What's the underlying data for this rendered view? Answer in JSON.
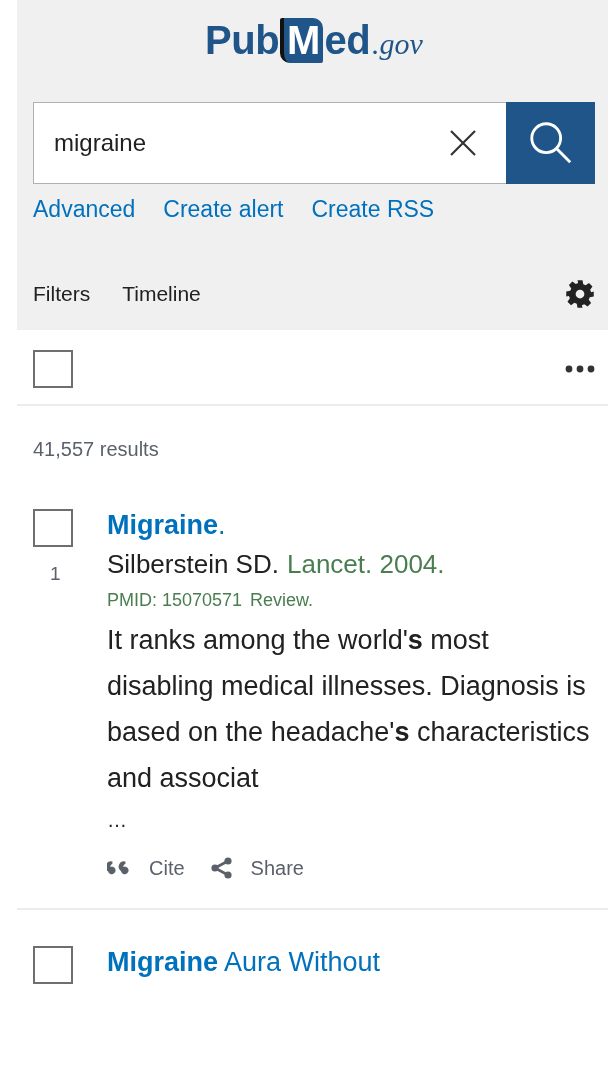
{
  "logo": {
    "parts": [
      "Pub",
      "M",
      "ed"
    ],
    "suffix": ".gov"
  },
  "search": {
    "value": "migraine"
  },
  "search_links": [
    "Advanced",
    "Create alert",
    "Create RSS"
  ],
  "tabs": [
    "Filters",
    "Timeline"
  ],
  "select_all": {
    "checked": false
  },
  "result_count": "41,557 results",
  "results": [
    {
      "checked": false,
      "number": "1",
      "title": "**Migraine**.",
      "authors": "Silberstein SD.",
      "source": "Lancet. 2004.",
      "pmid": "PMID: 15070571",
      "pub_type": "Review.",
      "snippet": "It ranks among the world'**s** most disabling medical illnesses. Diagnosis is based on the headache'**s** characteristics and associat",
      "ellipsis": "…",
      "actions": [
        {
          "kind": "cite",
          "label": "Cite"
        },
        {
          "kind": "share",
          "label": "Share"
        }
      ]
    },
    {
      "checked": false,
      "title": "**Migraine** Aura Without"
    }
  ]
}
